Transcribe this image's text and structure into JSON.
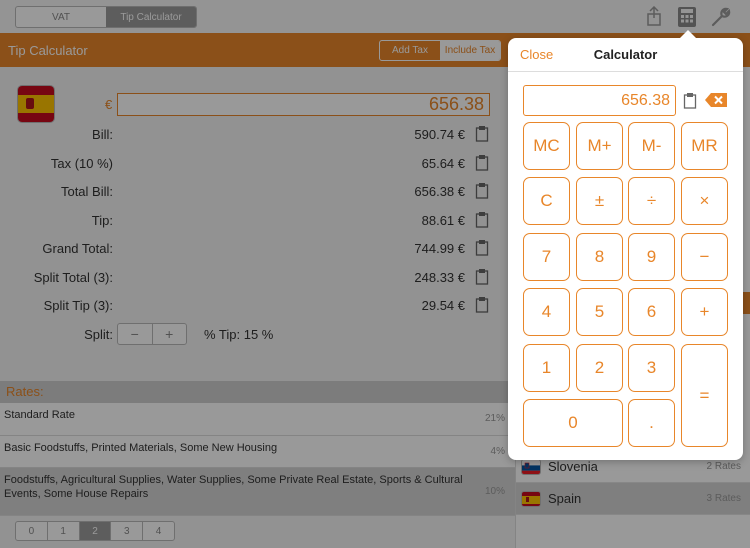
{
  "topbar": {
    "tabs": [
      {
        "label": "VAT",
        "active": false
      },
      {
        "label": "Tip Calculator",
        "active": true
      }
    ]
  },
  "header": {
    "title": "Tip Calculator",
    "tax_toggle": [
      {
        "label": "Add Tax",
        "active": false
      },
      {
        "label": "Include Tax",
        "active": true
      }
    ]
  },
  "calculator_form": {
    "currency_symbol": "€",
    "amount": "656.38",
    "rows": [
      {
        "label": "Bill:",
        "value": "590.74 €"
      },
      {
        "label": "Tax (10 %)",
        "value": "65.64 €"
      },
      {
        "label": "Total Bill:",
        "value": "656.38 €"
      },
      {
        "label": "Tip:",
        "value": "88.61 €"
      },
      {
        "label": "Grand Total:",
        "value": "744.99 €"
      },
      {
        "label": "Split Total (3):",
        "value": "248.33 €"
      },
      {
        "label": "Split Tip (3):",
        "value": "29.54 €"
      }
    ],
    "split_label": "Split:",
    "stepper_minus": "−",
    "stepper_plus": "+",
    "tip_percent": "% Tip: 15 %"
  },
  "rates": {
    "header": "Rates:",
    "items": [
      {
        "text": "Standard Rate",
        "percent": "21%",
        "selected": false
      },
      {
        "text": "Basic Foodstuffs, Printed Materials, Some New Housing",
        "percent": "4%",
        "selected": false
      },
      {
        "text": "Foodstuffs, Agricultural Supplies, Water Supplies, Some Private Real Estate, Sports & Cultural Events, Some House Repairs",
        "percent": "10%",
        "selected": true
      }
    ]
  },
  "pager": {
    "pages": [
      "0",
      "1",
      "2",
      "3",
      "4"
    ],
    "active_index": 2
  },
  "countries": [
    {
      "name": "Slovenia",
      "rates": "2 Rates",
      "selected": false
    },
    {
      "name": "Spain",
      "rates": "3 Rates",
      "selected": true
    }
  ],
  "popover": {
    "close_label": "Close",
    "title": "Calculator",
    "display": "656.38",
    "keys": [
      "MC",
      "M+",
      "M-",
      "MR",
      "C",
      "±",
      "÷",
      "×",
      "7",
      "8",
      "9",
      "−",
      "4",
      "5",
      "6",
      "+",
      "1",
      "2",
      "3",
      "=",
      "0",
      "."
    ]
  },
  "colors": {
    "accent": "#e8862a"
  }
}
